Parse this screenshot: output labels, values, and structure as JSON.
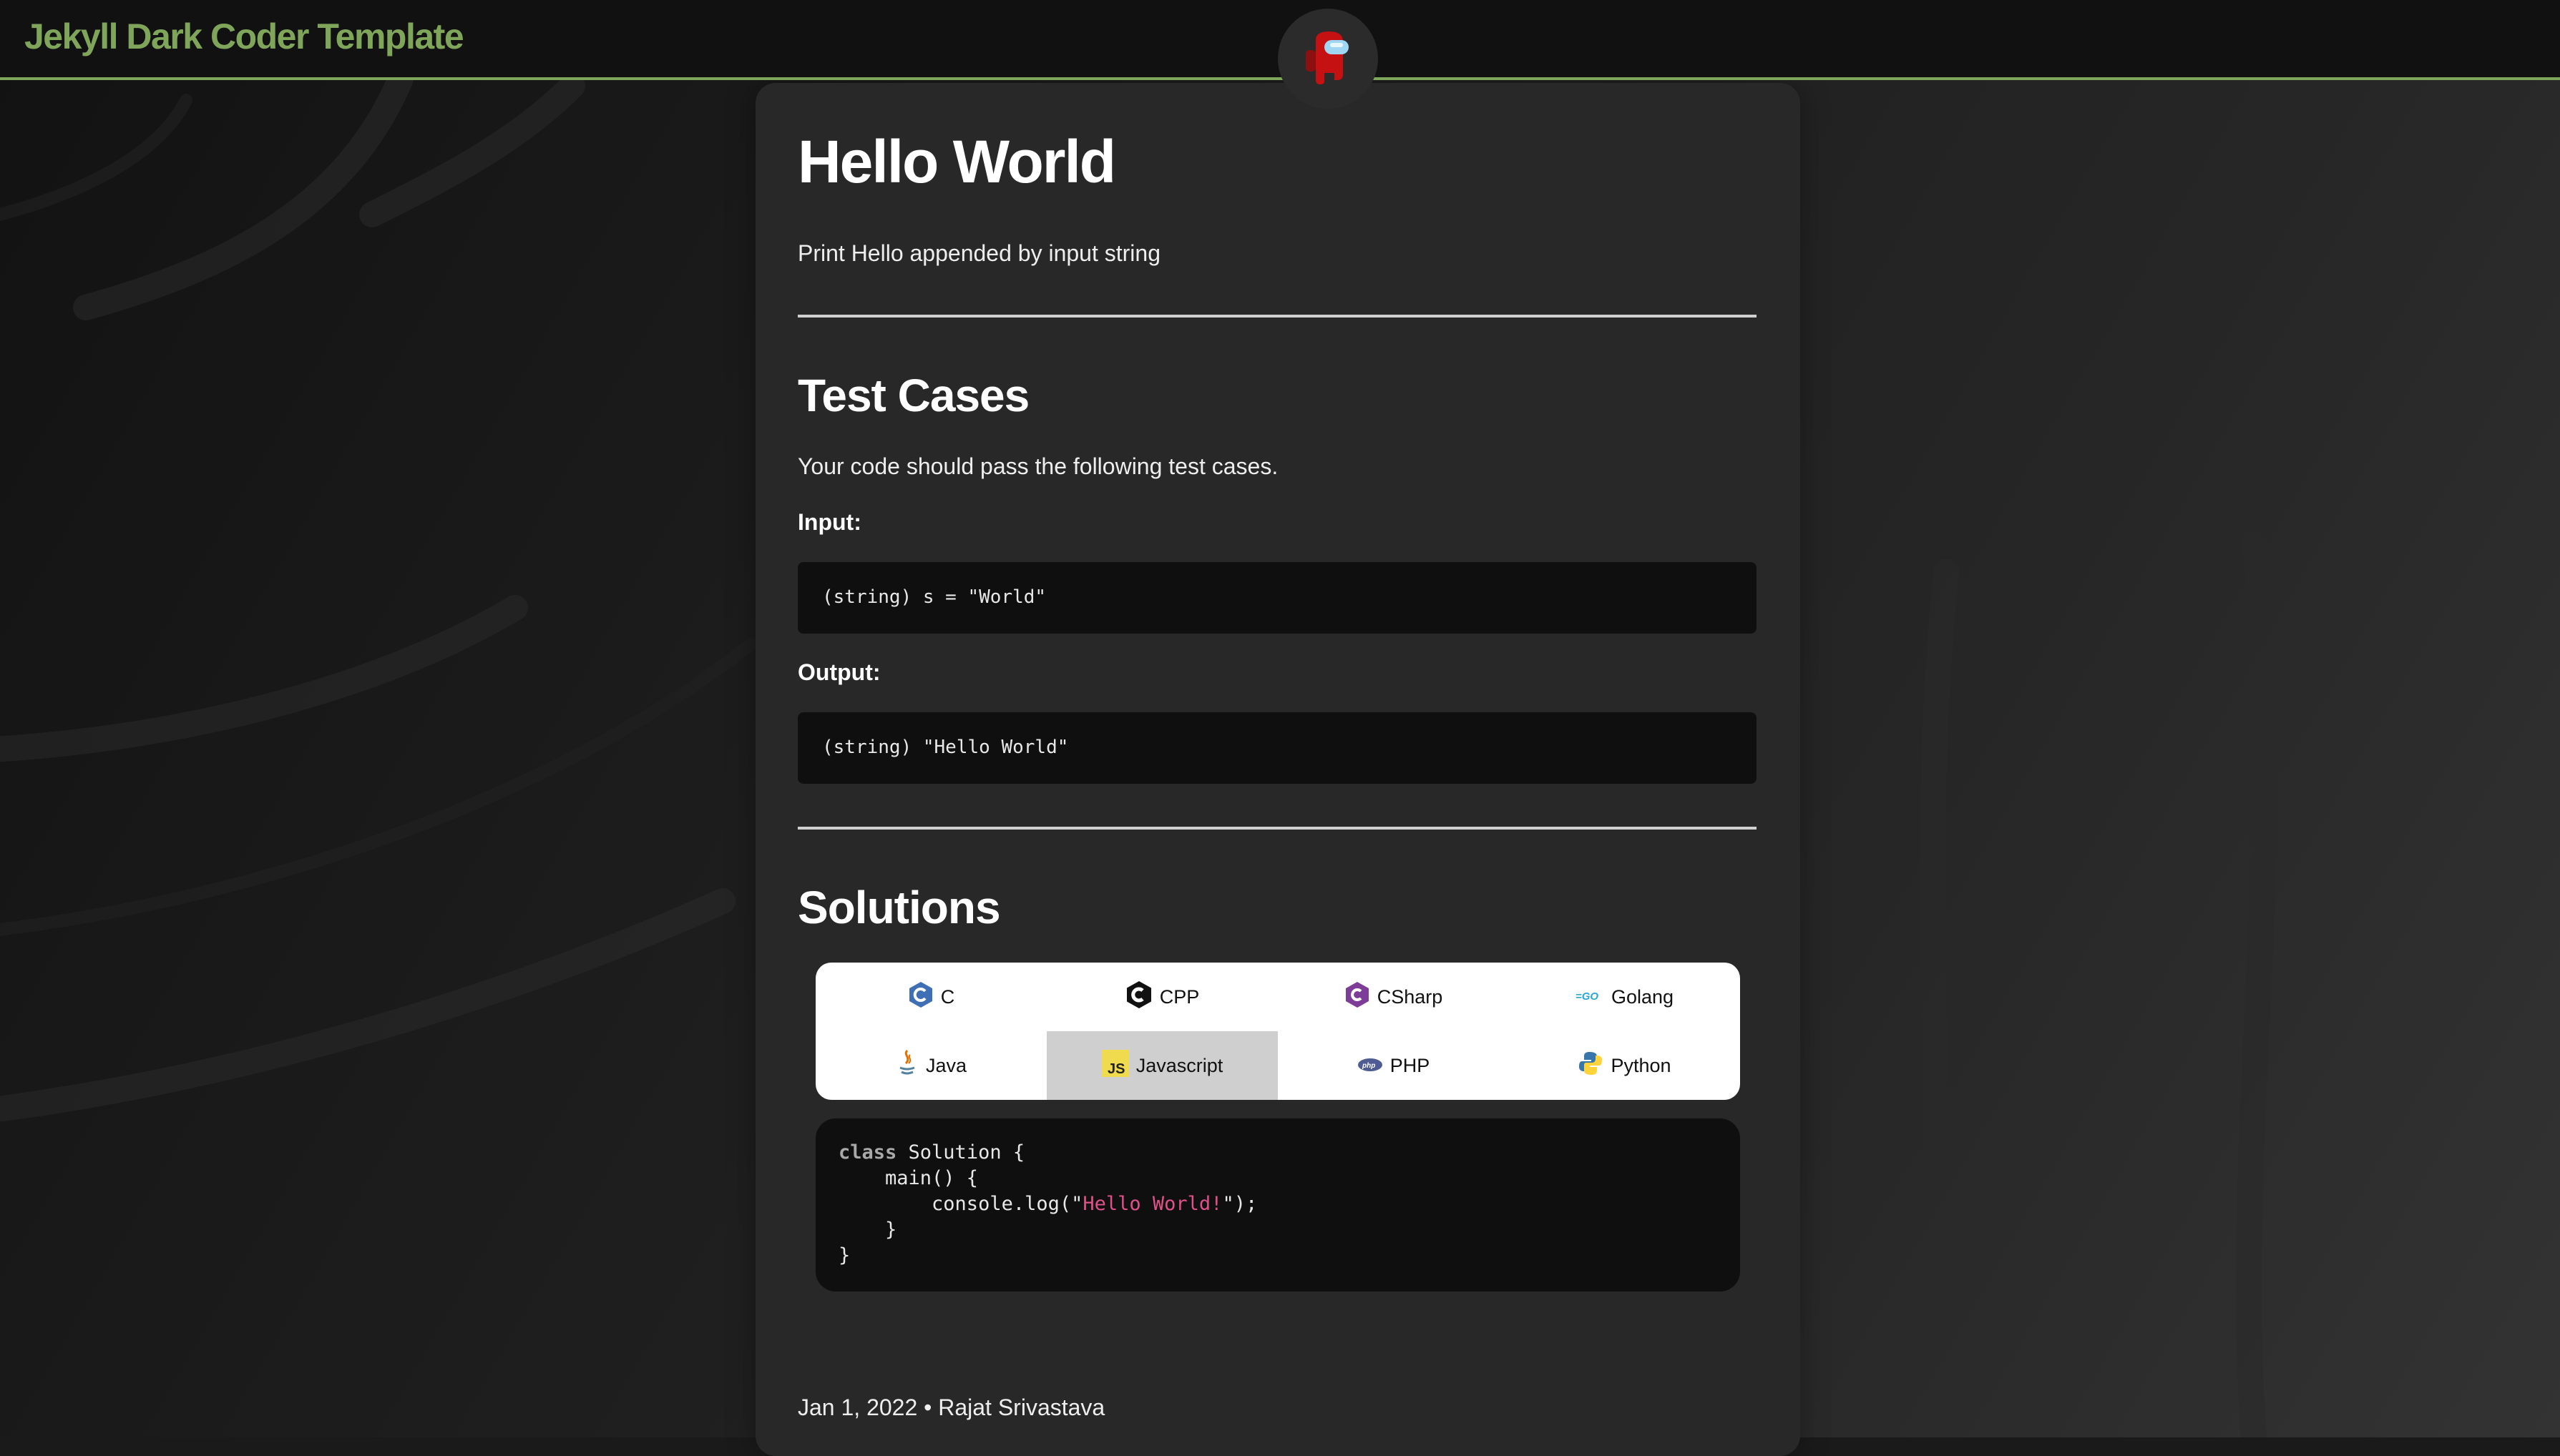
{
  "header": {
    "site_title": "Jekyll Dark Coder Template",
    "accent_color": "#7fa55a",
    "avatar_icon": "among-us-crewmate-icon"
  },
  "post": {
    "title": "Hello World",
    "description": "Print Hello appended by input string",
    "test_cases": {
      "heading": "Test Cases",
      "intro": "Your code should pass the following test cases.",
      "input_label": "Input:",
      "input_value": "(string) s = \"World\"",
      "output_label": "Output:",
      "output_value": "(string) \"Hello World\""
    },
    "solutions": {
      "heading": "Solutions",
      "tabs": [
        {
          "label": "C",
          "icon": "c-language-icon"
        },
        {
          "label": "CPP",
          "icon": "cpp-language-icon"
        },
        {
          "label": "CSharp",
          "icon": "csharp-language-icon"
        },
        {
          "label": "Golang",
          "icon": "go-language-icon"
        },
        {
          "label": "Java",
          "icon": "java-language-icon"
        },
        {
          "label": "Javascript",
          "icon": "javascript-language-icon",
          "active": true
        },
        {
          "label": "PHP",
          "icon": "php-language-icon"
        },
        {
          "label": "Python",
          "icon": "python-language-icon"
        }
      ],
      "code": {
        "line1_kw": "class",
        "line1_rest": " Solution {",
        "line2": "    main() {",
        "line3_pre": "        console.log(\"",
        "line3_str": "Hello World!",
        "line3_post": "\");",
        "line4": "    }",
        "line5": "}"
      }
    },
    "meta": "Jan 1, 2022 • Rajat Srivastava"
  }
}
